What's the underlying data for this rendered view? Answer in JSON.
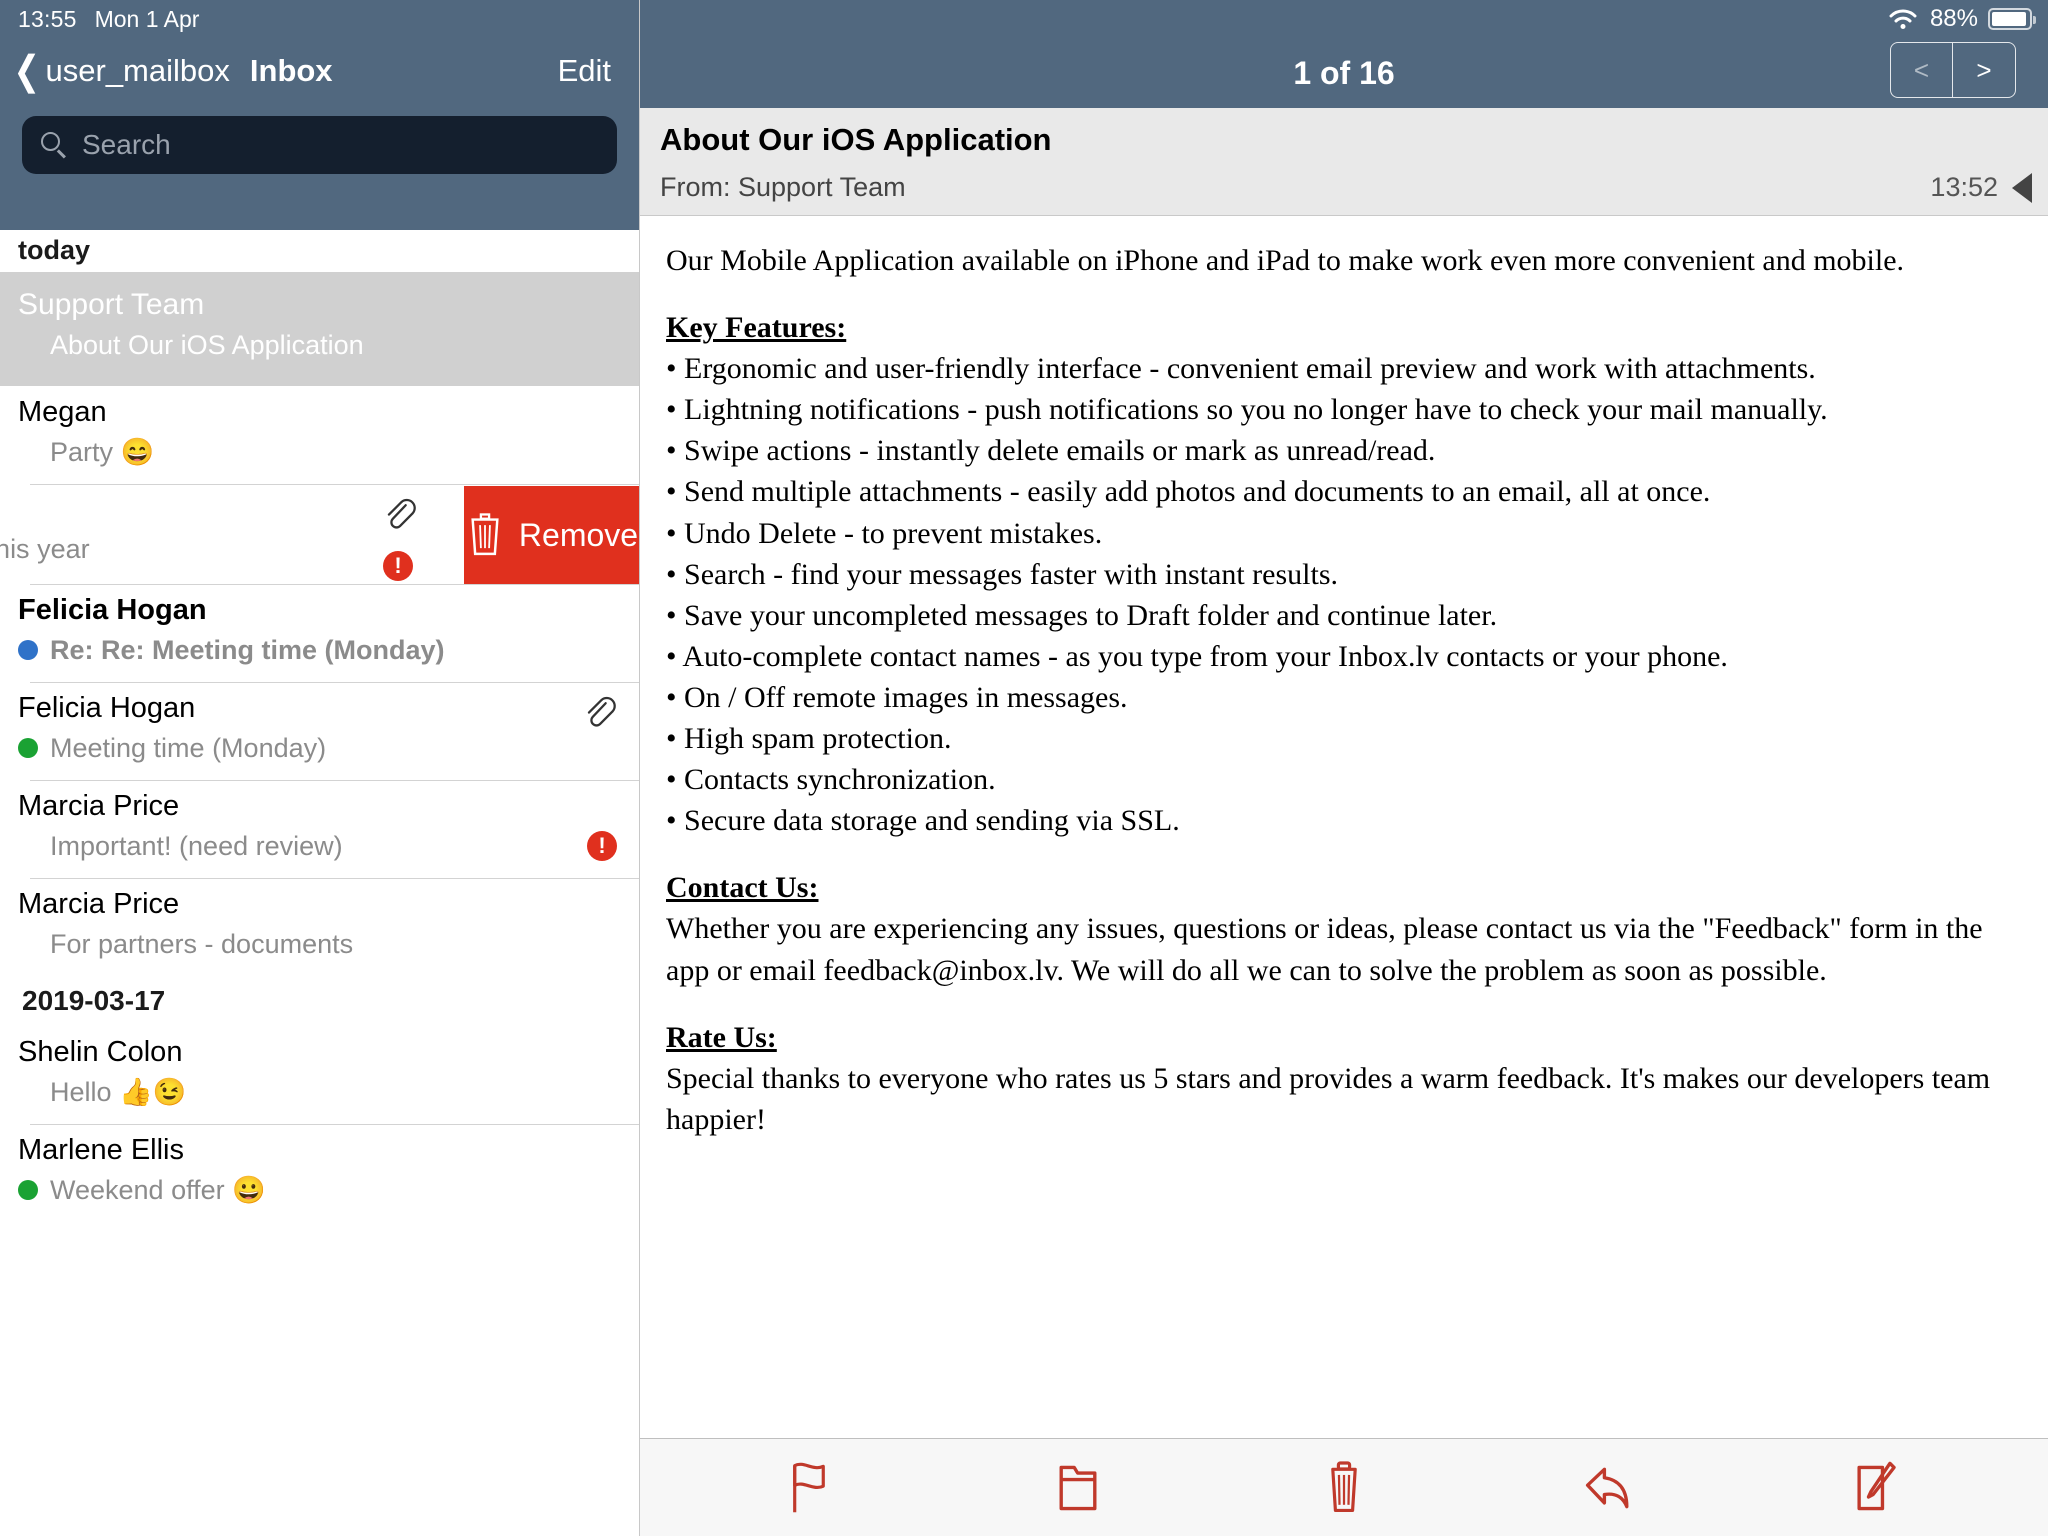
{
  "status_bar": {
    "time": "13:55",
    "date": "Mon 1 Apr",
    "battery_percent": "88%",
    "wifi_icon": "wifi-icon",
    "battery_icon": "battery-icon"
  },
  "colors": {
    "header": "#51687f",
    "search_field": "#141f2e",
    "accent_red": "#e0301e",
    "selected_row": "#d0d0d0",
    "unread_blue": "#2f72c8",
    "flag_green": "#1aa233"
  },
  "sidebar": {
    "back_label": "user_mailbox",
    "title": "Inbox",
    "edit_label": "Edit",
    "search": {
      "placeholder": "Search",
      "value": "",
      "icon": "search-icon"
    },
    "sections": [
      {
        "header": "today",
        "rows": [
          {
            "sender": "Support Team",
            "subject": "About Our iOS Application",
            "selected": true,
            "unread": false,
            "flag_color": "",
            "attachment": false,
            "important": false
          },
          {
            "sender": "Megan",
            "subject": "Party 😄",
            "selected": false,
            "unread": false,
            "flag_color": "",
            "attachment": false,
            "important": false
          },
          {
            "swiped": true,
            "sender": "",
            "subject": "ents for this year",
            "attachment": true,
            "important": true,
            "remove_label": "Remove",
            "trash_icon": "trash-icon"
          },
          {
            "sender": "Felicia Hogan",
            "subject": "Re: Re: Meeting time (Monday)",
            "selected": false,
            "unread": true,
            "flag_color": "#2f72c8",
            "attachment": false,
            "important": false
          },
          {
            "sender": "Felicia Hogan",
            "subject": "Meeting time (Monday)",
            "selected": false,
            "unread": false,
            "flag_color": "#1aa233",
            "attachment": true,
            "important": false
          },
          {
            "sender": "Marcia Price",
            "subject": "Important! (need review)",
            "selected": false,
            "unread": false,
            "flag_color": "",
            "attachment": false,
            "important": true
          },
          {
            "sender": "Marcia Price",
            "subject": "For partners - documents",
            "selected": false,
            "unread": false,
            "flag_color": "",
            "attachment": false,
            "important": false
          }
        ]
      },
      {
        "header": "2019-03-17",
        "rows": [
          {
            "sender": "Shelin Colon",
            "subject": "Hello 👍😉",
            "selected": false,
            "unread": false,
            "flag_color": "",
            "attachment": false,
            "important": false
          },
          {
            "sender": "Marlene    Ellis",
            "subject": "Weekend offer 😀",
            "selected": false,
            "unread": false,
            "flag_color": "#1aa233",
            "attachment": false,
            "important": false
          }
        ]
      }
    ]
  },
  "reader": {
    "page_count": "1 of 16",
    "prev_label": "<",
    "next_label": ">",
    "subject": "About Our iOS Application",
    "from": "From: Support Team",
    "time": "13:52",
    "reply_indicator_icon": "reply-triangle-icon",
    "body": {
      "intro": "Our Mobile Application available on iPhone and iPad to make work even more convenient and mobile.",
      "key_features_title": "Key Features:",
      "features": [
        "• Ergonomic and user-friendly interface - convenient email preview and work with attachments.",
        "• Lightning notifications - push notifications so you no longer have to check your mail manually.",
        "• Swipe actions - instantly delete emails or mark as unread/read.",
        "• Send multiple attachments - easily add photos and documents to an email, all at once.",
        "• Undo Delete - to prevent mistakes.",
        "• Search - find your messages faster with instant results.",
        "• Save your uncompleted messages to Draft folder and continue later.",
        "• Auto-complete contact names - as you type from your Inbox.lv contacts or your phone.",
        "• On / Off remote images in messages.",
        "• High spam protection.",
        "• Contacts synchronization.",
        "• Secure data storage and sending via SSL."
      ],
      "contact_title": "Contact Us: ",
      "contact_text": "Whether you are experiencing any issues, questions or ideas, please contact us via the \"Feedback\" form in the app or email feedback@inbox.lv. We will do all we can to solve the problem as soon as possible.",
      "rate_title": "Rate Us:",
      "rate_text": "Special thanks to everyone who rates us 5 stars and provides a warm feedback. It's makes our developers team happier!"
    },
    "toolbar": [
      {
        "icon": "flag-icon",
        "name": "flag-button"
      },
      {
        "icon": "folder-icon",
        "name": "move-to-folder-button"
      },
      {
        "icon": "trash-icon",
        "name": "delete-button"
      },
      {
        "icon": "reply-icon",
        "name": "reply-button"
      },
      {
        "icon": "compose-icon",
        "name": "compose-button"
      }
    ]
  }
}
